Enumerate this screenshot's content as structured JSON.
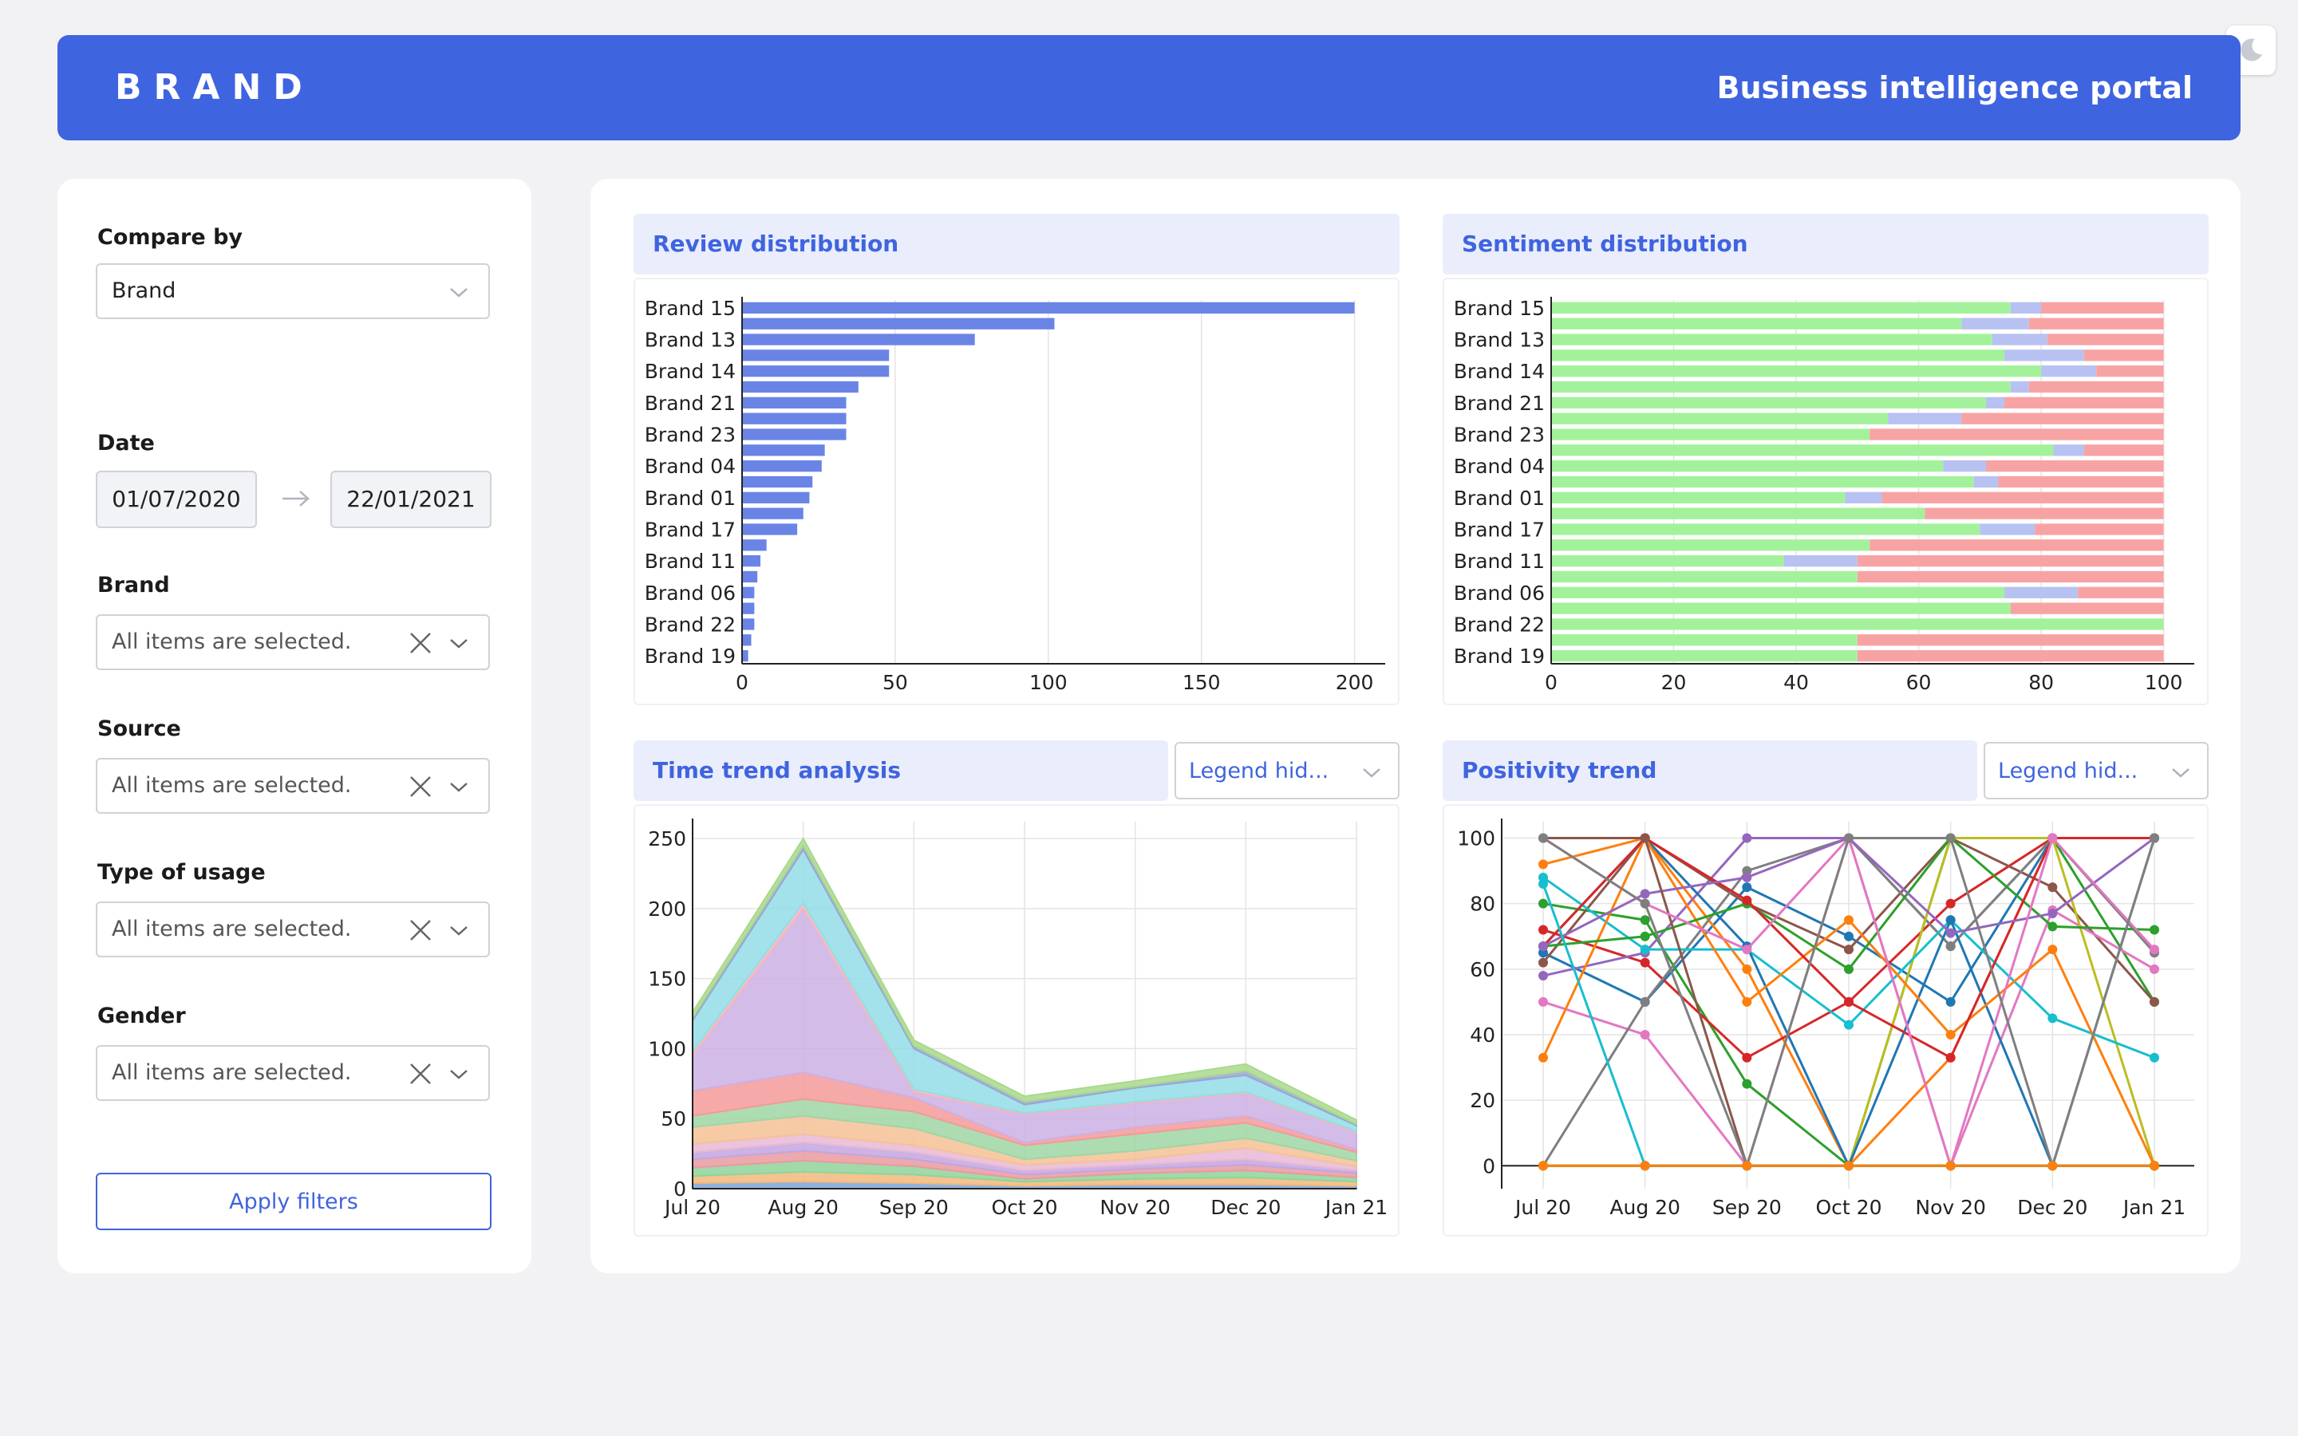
{
  "header": {
    "brand": "BRAND",
    "title": "Business intelligence portal"
  },
  "theme_toggle": {
    "icon": "moon-icon"
  },
  "filters": {
    "compare_by": {
      "label": "Compare by",
      "value": "Brand"
    },
    "date": {
      "label": "Date",
      "start": "01/07/2020",
      "end": "22/01/2021",
      "separator_icon": "arrow-right-icon"
    },
    "brand": {
      "label": "Brand",
      "placeholder": "All items are selected."
    },
    "source": {
      "label": "Source",
      "placeholder": "All items are selected."
    },
    "usage": {
      "label": "Type of usage",
      "placeholder": "All items are selected."
    },
    "gender": {
      "label": "Gender",
      "placeholder": "All items are selected."
    },
    "apply_label": "Apply filters"
  },
  "panels": {
    "review": {
      "title": "Review distribution"
    },
    "sentiment": {
      "title": "Sentiment distribution"
    },
    "time_trend": {
      "title": "Time trend analysis",
      "legend_select": "Legend hid..."
    },
    "positivity": {
      "title": "Positivity trend",
      "legend_select": "Legend hid..."
    }
  },
  "colors": {
    "accent": "#3f64df",
    "bar": "#6a84e6",
    "positive": "#a3f29b",
    "neutral": "#b7c2f2",
    "negative": "#f8a3a3"
  },
  "chart_data": [
    {
      "type": "bar",
      "orientation": "horizontal",
      "categories": [
        "Brand 15",
        "Brand 13",
        "Brand 14",
        "Brand 21",
        "Brand 23",
        "Brand 04",
        "Brand 01",
        "Brand 17",
        "Brand 11",
        "Brand 06",
        "Brand 22",
        "Brand 19"
      ],
      "all_bar_values": [
        200,
        102,
        76,
        48,
        48,
        38,
        34,
        34,
        34,
        27,
        26,
        23,
        22,
        20,
        18,
        8,
        6,
        5,
        4,
        4,
        4,
        3,
        2
      ],
      "tick_label_every": 2,
      "xticks": [
        0,
        50,
        100,
        150,
        200
      ],
      "xlim": [
        0,
        210
      ],
      "grid": true
    },
    {
      "type": "bar",
      "orientation": "horizontal",
      "stacked": true,
      "categories": [
        "Brand 15",
        "Brand 13",
        "Brand 14",
        "Brand 21",
        "Brand 23",
        "Brand 04",
        "Brand 01",
        "Brand 17",
        "Brand 11",
        "Brand 06",
        "Brand 22",
        "Brand 19"
      ],
      "series_order": [
        "positive",
        "neutral",
        "negative"
      ],
      "rows": [
        [
          75,
          5,
          20
        ],
        [
          67,
          11,
          22
        ],
        [
          72,
          9,
          19
        ],
        [
          74,
          13,
          13
        ],
        [
          80,
          9,
          11
        ],
        [
          75,
          3,
          22
        ],
        [
          71,
          3,
          26
        ],
        [
          55,
          12,
          33
        ],
        [
          52,
          0,
          48
        ],
        [
          82,
          5,
          13
        ],
        [
          64,
          7,
          29
        ],
        [
          69,
          4,
          27
        ],
        [
          48,
          6,
          46
        ],
        [
          61,
          0,
          39
        ],
        [
          70,
          9,
          21
        ],
        [
          52,
          0,
          48
        ],
        [
          38,
          12,
          50
        ],
        [
          50,
          0,
          50
        ],
        [
          74,
          12,
          14
        ],
        [
          75,
          0,
          25
        ],
        [
          100,
          0,
          0
        ],
        [
          50,
          0,
          50
        ],
        [
          50,
          0,
          50
        ]
      ],
      "tick_label_every": 2,
      "xticks": [
        0,
        20,
        40,
        60,
        80,
        100
      ],
      "xlim": [
        0,
        105
      ],
      "grid": true
    },
    {
      "type": "area",
      "stacked": true,
      "x": [
        "Jul 20",
        "Aug 20",
        "Sep 20",
        "Oct 20",
        "Nov 20",
        "Dec 20",
        "Jan 21"
      ],
      "yticks": [
        0,
        50,
        100,
        150,
        200,
        250
      ],
      "ylim": [
        0,
        262
      ],
      "grid": true,
      "series": [
        {
          "color": "#7ea3d9",
          "values": [
            4,
            5,
            4,
            2,
            3,
            3,
            2
          ]
        },
        {
          "color": "#f2b97c",
          "values": [
            5,
            7,
            6,
            3,
            4,
            5,
            3
          ]
        },
        {
          "color": "#8fd49a",
          "values": [
            6,
            8,
            6,
            2,
            4,
            5,
            3
          ]
        },
        {
          "color": "#e99aa0",
          "values": [
            6,
            7,
            5,
            3,
            3,
            4,
            3
          ]
        },
        {
          "color": "#c3a5e0",
          "values": [
            5,
            6,
            5,
            3,
            3,
            4,
            2
          ]
        },
        {
          "color": "#e8b8d4",
          "values": [
            6,
            6,
            5,
            4,
            4,
            8,
            3
          ]
        },
        {
          "color": "#f6c197",
          "values": [
            12,
            13,
            12,
            4,
            6,
            7,
            4
          ]
        },
        {
          "color": "#9fd6a6",
          "values": [
            8,
            12,
            12,
            10,
            12,
            11,
            6
          ]
        },
        {
          "color": "#f39a9a",
          "values": [
            18,
            19,
            10,
            2,
            5,
            5,
            2
          ]
        },
        {
          "color": "#cdb0e4",
          "values": [
            25,
            117,
            4,
            20,
            17,
            16,
            12
          ]
        },
        {
          "color": "#f4b6bf",
          "values": [
            3,
            4,
            2,
            1,
            1,
            1,
            1
          ]
        },
        {
          "color": "#93dde6",
          "values": [
            22,
            38,
            29,
            6,
            10,
            12,
            4
          ]
        },
        {
          "color": "#9aa5d6",
          "values": [
            2,
            3,
            2,
            2,
            1,
            3,
            1
          ]
        },
        {
          "color": "#a9d98c",
          "values": [
            4,
            5,
            4,
            4,
            4,
            5,
            3
          ]
        }
      ]
    },
    {
      "type": "line",
      "x": [
        "Jul 20",
        "Aug 20",
        "Sep 20",
        "Oct 20",
        "Nov 20",
        "Dec 20",
        "Jan 21"
      ],
      "yticks": [
        0,
        20,
        40,
        60,
        80,
        100
      ],
      "ylim": [
        -7,
        105
      ],
      "grid": true,
      "series": [
        {
          "color": "#1f77b4",
          "values": [
            65,
            50,
            85,
            70,
            50,
            100,
            100
          ]
        },
        {
          "color": "#ff7f0e",
          "values": [
            92,
            100,
            60,
            0,
            33,
            100,
            100
          ]
        },
        {
          "color": "#2ca02c",
          "values": [
            80,
            75,
            25,
            0,
            100,
            100,
            50
          ]
        },
        {
          "color": "#d62728",
          "values": [
            72,
            62,
            33,
            50,
            80,
            100,
            100
          ]
        },
        {
          "color": "#9467bd",
          "values": [
            58,
            65,
            100,
            100,
            67,
            100,
            100
          ]
        },
        {
          "color": "#8c564b",
          "values": [
            62,
            100,
            80,
            66,
            100,
            85,
            50
          ]
        },
        {
          "color": "#e377c2",
          "values": [
            50,
            40,
            0,
            100,
            0,
            78,
            60
          ]
        },
        {
          "color": "#7f7f7f",
          "values": [
            0,
            50,
            90,
            100,
            67,
            100,
            65
          ]
        },
        {
          "color": "#bcbd22",
          "values": [
            0,
            0,
            0,
            0,
            100,
            100,
            0
          ]
        },
        {
          "color": "#17becf",
          "values": [
            88,
            66,
            66,
            43,
            75,
            45,
            33
          ]
        },
        {
          "color": "#1f77b4",
          "values": [
            67,
            100,
            67,
            0,
            75,
            0,
            100
          ]
        },
        {
          "color": "#ff7f0e",
          "values": [
            33,
            100,
            50,
            75,
            40,
            66,
            0
          ]
        },
        {
          "color": "#2ca02c",
          "values": [
            67,
            70,
            80,
            60,
            100,
            73,
            72
          ]
        },
        {
          "color": "#d62728",
          "values": [
            67,
            100,
            81,
            50,
            33,
            100,
            100
          ]
        },
        {
          "color": "#9467bd",
          "values": [
            67,
            83,
            88,
            100,
            71,
            77,
            100
          ]
        },
        {
          "color": "#8c564b",
          "values": [
            100,
            100,
            0,
            0,
            0,
            0,
            0
          ]
        },
        {
          "color": "#e377c2",
          "values": [
            100,
            80,
            66,
            100,
            0,
            100,
            66
          ]
        },
        {
          "color": "#7f7f7f",
          "values": [
            100,
            80,
            0,
            100,
            100,
            0,
            100
          ]
        },
        {
          "color": "#17becf",
          "values": [
            86,
            0,
            0,
            0,
            0,
            0,
            0
          ]
        },
        {
          "color": "#2ca02c",
          "values": [
            0,
            0,
            0,
            0,
            0,
            0,
            0
          ]
        },
        {
          "color": "#ff7f0e",
          "values": [
            0,
            0,
            0,
            0,
            0,
            0,
            0
          ]
        }
      ]
    }
  ]
}
